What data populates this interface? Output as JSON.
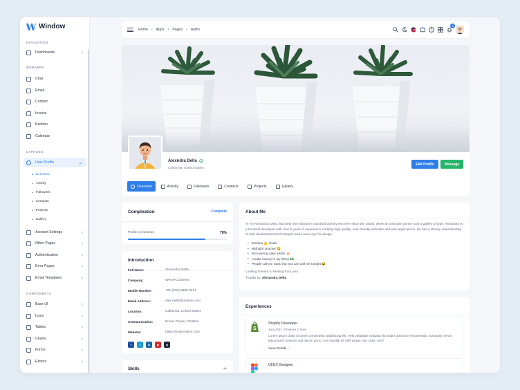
{
  "app": {
    "name": "Window"
  },
  "sidebar": {
    "sections": {
      "navigation": "NAVIGATION",
      "webapps": "WEBAPPS",
      "uipages": "UI PAGES",
      "components": "COMPONENTS"
    },
    "items": [
      {
        "label": "Dashboards",
        "chevron": true
      },
      {
        "label": "Chat"
      },
      {
        "label": "Email"
      },
      {
        "label": "Contact"
      },
      {
        "label": "Invoice"
      },
      {
        "label": "Kanban"
      },
      {
        "label": "Calendar"
      },
      {
        "label": "User Profile",
        "chevron": true
      },
      {
        "label": "Account Settings",
        "chevron": true
      },
      {
        "label": "Other Pages",
        "chevron": true
      },
      {
        "label": "Authentication",
        "chevron": true
      },
      {
        "label": "Error Pages",
        "chevron": true
      },
      {
        "label": "Email Templates",
        "chevron": true
      },
      {
        "label": "Base UI",
        "chevron": true
      },
      {
        "label": "Icons",
        "chevron": true
      },
      {
        "label": "Tables",
        "chevron": true
      },
      {
        "label": "Charts",
        "chevron": true
      },
      {
        "label": "Forms",
        "chevron": true
      },
      {
        "label": "Editors",
        "chevron": true
      }
    ],
    "subitems": [
      "Overview",
      "Activity",
      "Followers",
      "Contacts",
      "Projects",
      "Gallery"
    ]
  },
  "topbar": {
    "breadcrumb": [
      "Home",
      "Apps",
      "Pages",
      "Auths"
    ],
    "notification_count": "5"
  },
  "profile": {
    "name": "Alexndra Della",
    "location": "California, United States",
    "edit_button": "Edit Profile",
    "message_button": "Message"
  },
  "tabs": [
    "Overview",
    "Activity",
    "Followers",
    "Contacts",
    "Projects",
    "Gallery"
  ],
  "completion": {
    "title": "Compleation",
    "link": "Complete",
    "label": "Profile completion",
    "value": "78%",
    "progress": 0.78
  },
  "intro": {
    "title": "Introduction",
    "rows": [
      {
        "key": "Full Name:",
        "value": "Alexandra Della"
      },
      {
        "key": "Company:",
        "value": "WRAPCODERS"
      },
      {
        "key": "Mobile Number:",
        "value": "+01 (375) 5896 3214"
      },
      {
        "key": "Email Address:",
        "value": "alex.della@outlook.com"
      },
      {
        "key": "Location:",
        "value": "California, United States"
      },
      {
        "key": "Communication:",
        "value": "Email, Phone, Chatbot"
      },
      {
        "key": "Website:",
        "value": "https://wrapcoders.com"
      }
    ]
  },
  "skills": {
    "title": "Skills"
  },
  "about": {
    "title": "About Me",
    "text": "Hi I'm Alexandra Della, has been the industry's standard dummy text ever since the 1500s, when an unknown printer took a gallery of type. Alexandra is a frontend developer with over 5 years of experience creating high-quality, user-friendly websites and web applications. He has a strong understanding of web development technologies and a keen eye for design.",
    "bullets": [
      "Dreams 👍 Goals",
      "Midnight snacker 😋",
      "Recovering cake addict 🎂",
      "I make money in my sleep 💵",
      "People call me Sara, but you can call me tonight 😂"
    ],
    "closing": "Looking forward to hearing from you!",
    "thanks_prefix": "Thanks by,",
    "thanks_name": "Alexandra Della"
  },
  "experiences": {
    "title": "Experiences",
    "items": [
      {
        "title": "Shopify Developer",
        "meta": "June 2022 - Present  •  2 Years",
        "desc": "Lorem ipsum dolor sit amet consectetur adipisicing elit. Velit voluptate voluptas illo totam ducimus! Assumenda, numquam rerum laboriosam nostrum odit harum porro, eos repellat sit nihil eaque nisi. Odio, eos?",
        "link": "View Details →"
      },
      {
        "title": "UI/UX Designer"
      }
    ]
  },
  "colors": {
    "accent": "#2f7ee8",
    "success": "#25b56b"
  }
}
